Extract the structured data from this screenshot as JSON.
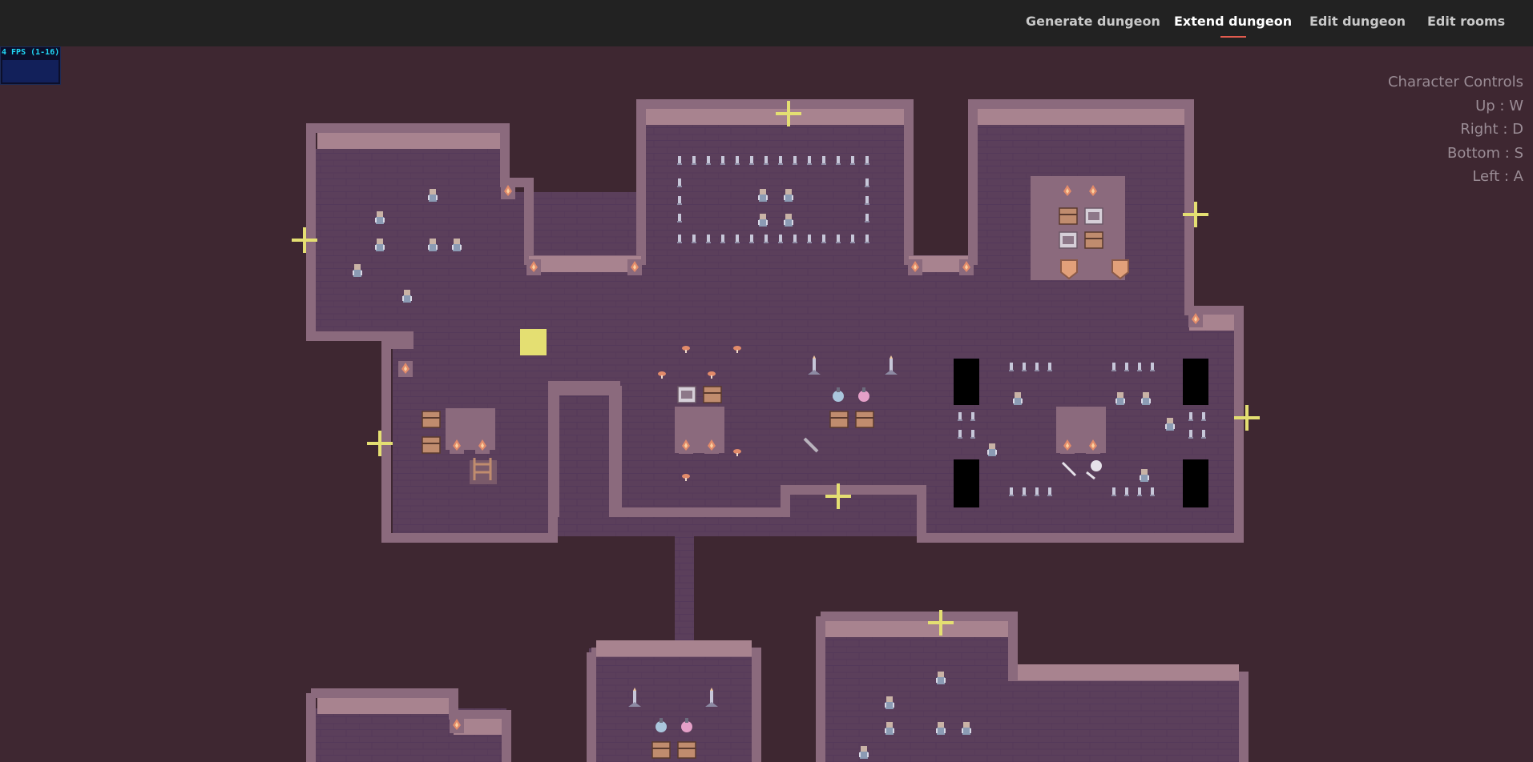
{
  "fps_meter": {
    "label": "4 FPS (1-16)"
  },
  "nav": {
    "tabs": [
      {
        "label": "Generate dungeon",
        "active": false
      },
      {
        "label": "Extend dungeon",
        "active": true
      },
      {
        "label": "Edit dungeon",
        "active": false
      },
      {
        "label": "Edit rooms",
        "active": false
      }
    ]
  },
  "controls": {
    "title": "Character Controls",
    "up": "Up : W",
    "right": "Right : D",
    "bottom": "Bottom : S",
    "left": "Left : A"
  },
  "colors": {
    "background": "#3e2731",
    "topbar": "#222222",
    "floor": "#5b3f5b",
    "wall": "#8b6a7d",
    "door_marker": "#e4df72",
    "player": "#e4df72",
    "active_underline": "#e25b4e"
  },
  "icons": [
    "door-marker-icon",
    "torch-icon",
    "chest-icon",
    "skeleton-icon",
    "potion-icon",
    "spikes-icon",
    "mushroom-icon",
    "ladder-icon",
    "candle-icon",
    "skull-icon"
  ]
}
